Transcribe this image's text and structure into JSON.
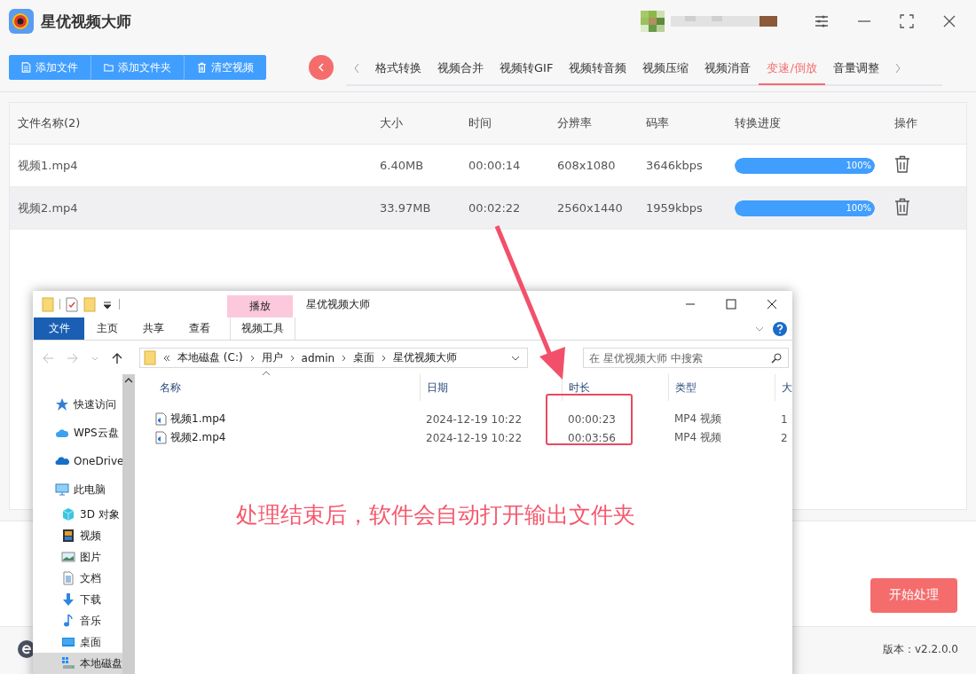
{
  "app": {
    "title": "星优视频大师"
  },
  "toolbar": {
    "buttons": [
      {
        "label": "添加文件",
        "kind": "file"
      },
      {
        "label": "添加文件夹",
        "kind": "folder"
      },
      {
        "label": "清空视频",
        "kind": "trash"
      }
    ]
  },
  "tabs": [
    {
      "label": "格式转换",
      "selected": false
    },
    {
      "label": "视频合并",
      "selected": false
    },
    {
      "label": "视频转GIF",
      "selected": false
    },
    {
      "label": "视频转音频",
      "selected": false
    },
    {
      "label": "视频压缩",
      "selected": false
    },
    {
      "label": "视频消音",
      "selected": false
    },
    {
      "label": "变速/倒放",
      "selected": true
    },
    {
      "label": "音量调整",
      "selected": false
    }
  ],
  "table": {
    "columns": [
      "文件名称(2)",
      "大小",
      "时间",
      "分辨率",
      "码率",
      "转换进度",
      "操作"
    ],
    "rows": [
      {
        "name": "视频1.mp4",
        "size": "6.40MB",
        "time": "00:00:14",
        "resolution": "608x1080",
        "bitrate": "3646kbps",
        "progress": {
          "level": 1,
          "label": "100%"
        },
        "selected": false
      },
      {
        "name": "视频2.mp4",
        "size": "33.97MB",
        "time": "00:02:22",
        "resolution": "2560x1440",
        "bitrate": "1959kbps",
        "progress": {
          "level": 1,
          "label": "100%"
        },
        "selected": true
      }
    ]
  },
  "start_button": "开始处理",
  "version": "版本：v2.2.0.0",
  "explorer": {
    "context_tab": "播放",
    "title": "星优视频大师",
    "ribbon_tabs": [
      {
        "label": "文件",
        "kind": "file"
      },
      {
        "label": "主页",
        "kind": "plain"
      },
      {
        "label": "共享",
        "kind": "plain"
      },
      {
        "label": "查看",
        "kind": "plain"
      },
      {
        "label": "视频工具",
        "kind": "contextual"
      }
    ],
    "breadcrumb": [
      "本地磁盘 (C:)",
      "用户",
      "admin",
      "桌面",
      "星优视频大师"
    ],
    "search": {
      "placeholder": "在 星优视频大师 中搜索"
    },
    "nav": [
      {
        "label": "快速访问",
        "kind": "star",
        "selected": false
      },
      {
        "label": "WPS云盘",
        "kind": "cloud",
        "selected": false
      },
      {
        "label": "OneDrive",
        "kind": "onedrive",
        "selected": false
      },
      {
        "label": "此电脑",
        "kind": "pc",
        "selected": false,
        "children": [
          {
            "label": "3D 对象",
            "kind": "cube",
            "selected": false
          },
          {
            "label": "视频",
            "kind": "film",
            "selected": false
          },
          {
            "label": "图片",
            "kind": "image",
            "selected": false
          },
          {
            "label": "文档",
            "kind": "doc",
            "selected": false
          },
          {
            "label": "下载",
            "kind": "download",
            "selected": false
          },
          {
            "label": "音乐",
            "kind": "music",
            "selected": false
          },
          {
            "label": "桌面",
            "kind": "desktop",
            "selected": false
          },
          {
            "label": "本地磁盘",
            "kind": "drive",
            "selected": true
          }
        ]
      }
    ],
    "columns": [
      "名称",
      "日期",
      "时长",
      "类型",
      "大"
    ],
    "files": [
      {
        "name": "视频1.mp4",
        "date": "2024-12-19 10:22",
        "duration": "00:00:23",
        "type": "MP4 视频",
        "size": "1"
      },
      {
        "name": "视频2.mp4",
        "date": "2024-12-19 10:22",
        "duration": "00:03:56",
        "type": "MP4 视频",
        "size": "2"
      }
    ]
  },
  "annotation": "处理结束后，软件会自动打开输出文件夹"
}
